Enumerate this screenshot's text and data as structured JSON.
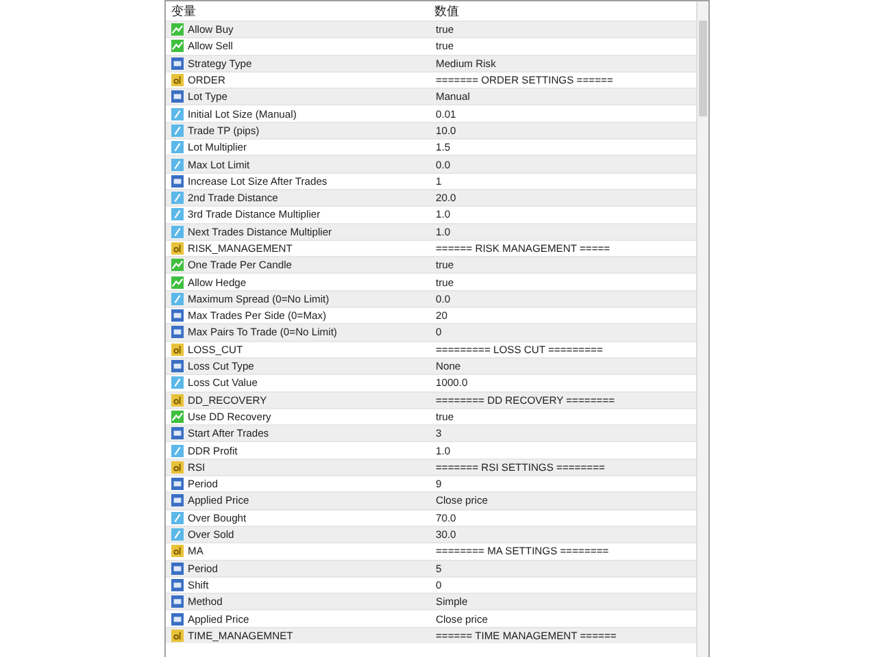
{
  "columns": [
    "变量",
    "数值"
  ],
  "rows": [
    {
      "kind": "bool",
      "name": "Allow Buy",
      "value": "true"
    },
    {
      "kind": "bool",
      "name": "Allow Sell",
      "value": "true"
    },
    {
      "kind": "enum",
      "name": "Strategy Type",
      "value": "Medium Risk"
    },
    {
      "kind": "string",
      "name": "ORDER",
      "value": "======= ORDER SETTINGS ======"
    },
    {
      "kind": "enum",
      "name": "Lot Type",
      "value": "Manual"
    },
    {
      "kind": "double",
      "name": "Initial Lot Size (Manual)",
      "value": "0.01"
    },
    {
      "kind": "double",
      "name": "Trade TP (pips)",
      "value": "10.0"
    },
    {
      "kind": "double",
      "name": "Lot Multiplier",
      "value": "1.5"
    },
    {
      "kind": "double",
      "name": "Max Lot Limit",
      "value": "0.0"
    },
    {
      "kind": "enum",
      "name": "Increase Lot Size After Trades",
      "value": "1"
    },
    {
      "kind": "double",
      "name": "2nd Trade Distance",
      "value": "20.0"
    },
    {
      "kind": "double",
      "name": "3rd Trade Distance Multiplier",
      "value": "1.0"
    },
    {
      "kind": "double",
      "name": "Next Trades Distance Multiplier",
      "value": "1.0"
    },
    {
      "kind": "string",
      "name": "RISK_MANAGEMENT",
      "value": "====== RISK MANAGEMENT ====="
    },
    {
      "kind": "bool",
      "name": "One Trade Per Candle",
      "value": "true"
    },
    {
      "kind": "bool",
      "name": "Allow Hedge",
      "value": "true"
    },
    {
      "kind": "double",
      "name": "Maximum Spread (0=No Limit)",
      "value": "0.0"
    },
    {
      "kind": "enum",
      "name": "Max Trades Per Side (0=Max)",
      "value": "20"
    },
    {
      "kind": "enum",
      "name": "Max Pairs To Trade (0=No Limit)",
      "value": "0"
    },
    {
      "kind": "string",
      "name": "LOSS_CUT",
      "value": "========= LOSS CUT ========="
    },
    {
      "kind": "enum",
      "name": "Loss Cut Type",
      "value": "None"
    },
    {
      "kind": "double",
      "name": "Loss Cut Value",
      "value": "1000.0"
    },
    {
      "kind": "string",
      "name": "DD_RECOVERY",
      "value": "======== DD RECOVERY ========"
    },
    {
      "kind": "bool",
      "name": "Use DD Recovery",
      "value": "true"
    },
    {
      "kind": "enum",
      "name": "Start After Trades",
      "value": "3"
    },
    {
      "kind": "double",
      "name": "DDR Profit",
      "value": "1.0"
    },
    {
      "kind": "string",
      "name": "RSI",
      "value": "======= RSI SETTINGS ========"
    },
    {
      "kind": "enum",
      "name": "Period",
      "value": "9"
    },
    {
      "kind": "enum",
      "name": "Applied Price",
      "value": "Close price"
    },
    {
      "kind": "double",
      "name": "Over Bought",
      "value": "70.0"
    },
    {
      "kind": "double",
      "name": "Over Sold",
      "value": "30.0"
    },
    {
      "kind": "string",
      "name": "MA",
      "value": "======== MA SETTINGS ========"
    },
    {
      "kind": "enum",
      "name": "Period",
      "value": "5"
    },
    {
      "kind": "enum",
      "name": "Shift",
      "value": "0"
    },
    {
      "kind": "enum",
      "name": "Method",
      "value": "Simple"
    },
    {
      "kind": "enum",
      "name": "Applied Price",
      "value": "Close price"
    },
    {
      "kind": "string",
      "name": "TIME_MANAGEMNET",
      "value": "====== TIME MANAGEMENT ======"
    }
  ]
}
